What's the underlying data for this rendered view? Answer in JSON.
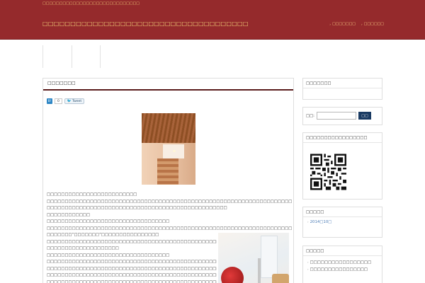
{
  "header": {
    "tagline": "□□□□□□□□□□□□□□□□□□□□□□□□□□□□□",
    "site_title": "□□□□□□□□□□□□□□□□□□□□□□□□□□□□□□□□□□□□□",
    "nav": [
      {
        "label": "□□□□□□□"
      },
      {
        "label": "□□□□□□"
      }
    ],
    "colors": {
      "header_bg": "#952a2c",
      "header_text": "#f3d27a"
    }
  },
  "post": {
    "title": "□□□□□□□",
    "hatena_label": "B!",
    "hatena_count": "0",
    "tweet_label": "Tweet",
    "paragraphs": [
      "□□□□□□□□□□□□□□□□□□□□□□□□□",
      "□□□□□□□□□□□□□□□□□□□□□□□□□□□□□□□□□□□□□□□□□□□□□□□□□□□□□□□□□□□□□□□□□□□□□□□□□□□□□□□□□□□□□□□□□□□…□□□",
      "□□□□□□□□□□□□□□□□□□□□□□□□□□□□□□□□□□□□□□□□□□□□□□□□□□",
      "□□□□□□□□□□□□",
      "□□□□□□□□□□□□□□□□□□□□□□□□□□□□□□□□□□",
      "□□□□□□□□□□□□□□□□□□□□□□□□□□□□□□□□□□□□□□□□□□□□□□□□□□□□□□□□□□□□□□□□□□□□□",
      "□□□□□□□“□□□□□□□”□□□□□□□□□□□□□□□□",
      "□□□□□□□□□□□□□□□□□□□□□□□□□□□□□□□□□□□□□□□□□□□□□□□□□□□□□□□□□□□□□□□□□□",
      "□□□□□□□□□□□□□□□□□□□□",
      "□□□□□□□□□□□□□□□□□□□□□□□□□□□□□□□□□□",
      "□□□□□□□□□□□□□□□□□□□□□□□□□□□□□□□□□□□□□□□□□□□□□□□□□□□□□□□□□□□□□□□□□□□",
      "□□□□□□□□□□□□□□□□□□□□□□□□□□□□□□□□□□□□□□□□□□□□□□□□□□□□□□□□□□□□□□□□□□□",
      "□□□□□□□□□□□□□□□□□□□□□□□□□□□□□□□□□□□□□□□□□□□□□□□□□□□□□□□□□□□□□□□□□□",
      "□□□□□□□□□□□□□□□□□□□□□□□□□□□□□□□□□□□□□□□□□□□□□□□□□□□□□□□□□□□□□□□□□□"
    ]
  },
  "sidebar": {
    "profile_title": "□□□□□□□",
    "search_label": "□□:",
    "search_value": "",
    "search_button": "□□",
    "qr_title": "□□□□□□□□□□□□□□□□□",
    "archive_title": "□□□□□",
    "archive_link": "2014□10□",
    "recent_title": "□□□□□",
    "recent_items": [
      "□□□□□□□□□□□□□□□□□",
      "□□□□□□□□□□□□□□□□"
    ]
  }
}
